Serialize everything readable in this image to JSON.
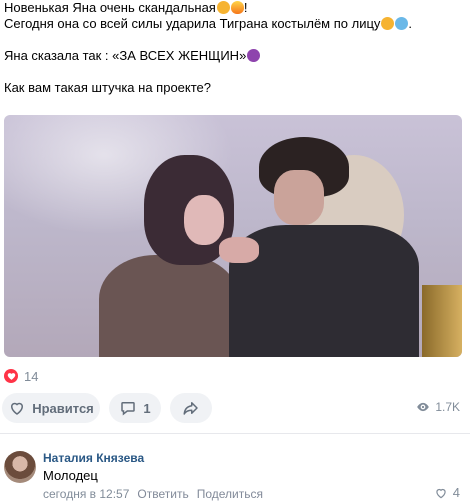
{
  "post": {
    "lines": [
      "Новенькая Яна очень скандальная",
      "!",
      "Сегодня она со всей силы ударила Тиграна костылём по лицу",
      ".",
      "Яна сказала так : «ЗА ВСЕХ ЖЕНЩИН»",
      "Как вам такая штучка на проекте?"
    ],
    "icons": [
      "face-emoji-icon",
      "fire-emoji-icon",
      "smile-emoji-icon",
      "scream-emoji-icon",
      "devil-emoji-icon"
    ]
  },
  "reactions": {
    "count": "14",
    "icon": "heart-icon"
  },
  "actions": {
    "like_label": "Нравится",
    "comment_count": "1",
    "share_icon": "share-arrow-icon",
    "views": "1.7K"
  },
  "comment": {
    "author": "Наталия Князева",
    "text": "Молодец",
    "time": "сегодня в 12:57",
    "reply_label": "Ответить",
    "share_label": "Поделиться",
    "likes": "4"
  },
  "colors": {
    "accent": "#2a5885",
    "muted": "#818c99",
    "heart": "#ff3347",
    "button_bg": "#f0f2f5"
  }
}
